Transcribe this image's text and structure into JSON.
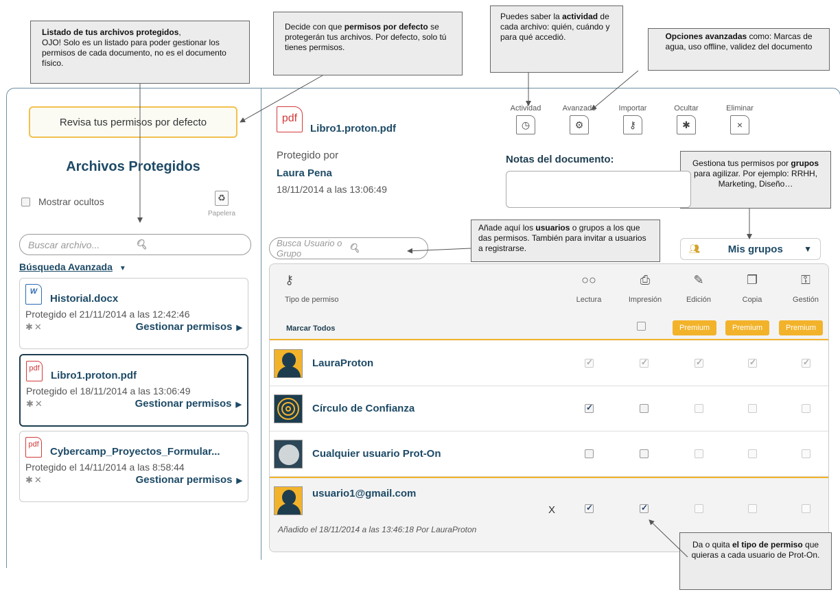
{
  "callouts": {
    "files_list": {
      "bold": "Listado de tus archivos protegidos",
      "text": "OJO! Solo es un listado para poder gestionar los permisos de cada documento, no es el documento físico."
    },
    "defaults": {
      "pre": "Decide con que ",
      "bold": "permisos por defecto",
      "text": " se protegerán tus archivos. Por defecto, solo tú tienes permisos."
    },
    "activity": {
      "pre": "Puedes saber la ",
      "bold": "actividad",
      "text": " de cada archivo: quién, cuándo y para qué accedió."
    },
    "advanced": {
      "bold": "Opciones avanzadas",
      "text": " como: Marcas de agua, uso offline, validez del documento"
    },
    "groups": {
      "pre": "Gestiona tus permisos por ",
      "bold": "grupos",
      "text": " para agilizar. Por ejemplo: RRHH, Marketing, Diseño…"
    },
    "users": {
      "pre": "Añade aquí los ",
      "bold": "usuarios",
      "text": " o grupos a los que das permisos. También para invitar a usuarios a registrarse."
    },
    "permission": {
      "pre": "Da o quita ",
      "bold": "el tipo de permiso",
      "text": " que quieras a cada usuario de Prot-On."
    }
  },
  "left": {
    "defaults_button": "Revisa tus permisos por defecto",
    "title": "Archivos Protegidos",
    "show_hidden": "Mostrar ocultos",
    "trash_label": "Papelera",
    "search_placeholder": "Buscar archivo...",
    "advanced_search": "Búsqueda Avanzada",
    "files": [
      {
        "type": "word",
        "icon_text": "W",
        "name": "Historial.docx",
        "date": "Protegido el 21/11/2014 a las 12:42:46",
        "manage": "Gestionar permisos"
      },
      {
        "type": "pdf",
        "icon_text": "pdf",
        "name": "Libro1.proton.pdf",
        "date": "Protegido el 18/11/2014 a las 13:06:49",
        "manage": "Gestionar permisos"
      },
      {
        "type": "pdf",
        "icon_text": "pdf",
        "name": "Cybercamp_Proyectos_Formular...",
        "date": "Protegido el 14/11/2014 a las 8:58:44",
        "manage": "Gestionar permisos"
      }
    ]
  },
  "document": {
    "icon_text": "pdf",
    "name": "Libro1.proton.pdf",
    "protected_by_label": "Protegido por",
    "owner": "Laura Pena",
    "date": "18/11/2014 a las 13:06:49",
    "notes_label": "Notas del documento:"
  },
  "actions": [
    {
      "label": "Actividad",
      "icon": "clock-icon",
      "glyph": "◷"
    },
    {
      "label": "Avanzado",
      "icon": "gear-icon",
      "glyph": "⚙"
    },
    {
      "label": "Importar",
      "icon": "key-icon",
      "glyph": "⚷"
    },
    {
      "label": "Ocultar",
      "icon": "hide-icon",
      "glyph": "✱"
    },
    {
      "label": "Eliminar",
      "icon": "close-icon",
      "glyph": "×"
    }
  ],
  "user_search_placeholder": "Busca Usuario o Grupo",
  "groups_button": "Mis grupos",
  "table": {
    "type_label": "Tipo de permiso",
    "columns": [
      {
        "label": "Lectura",
        "icon": "glasses-icon",
        "glyph": "○○"
      },
      {
        "label": "Impresión",
        "icon": "printer-icon",
        "glyph": "⎙"
      },
      {
        "label": "Edición",
        "icon": "pencil-icon",
        "glyph": "✎"
      },
      {
        "label": "Copia",
        "icon": "copy-icon",
        "glyph": "❐"
      },
      {
        "label": "Gestión",
        "icon": "key-icon",
        "glyph": "⚿"
      }
    ],
    "mark_all": "Marcar Todos",
    "premium": "Premium",
    "users": [
      {
        "name": "LauraProton",
        "avatar": "person",
        "perms": [
          true,
          true,
          true,
          true,
          true
        ],
        "dim": true
      },
      {
        "name": "Círculo de Confianza",
        "avatar": "target",
        "perms": [
          true,
          false,
          false,
          false,
          false
        ],
        "dim": false
      },
      {
        "name": "Cualquier usuario Prot-On",
        "avatar": "world",
        "perms": [
          false,
          false,
          false,
          false,
          false
        ],
        "dim": false
      },
      {
        "name": "usuario1@gmail.com",
        "avatar": "person",
        "perms": [
          true,
          true,
          false,
          false,
          false
        ],
        "dim": false,
        "remove": "X",
        "added": "Añadido el 18/11/2014 a las 13:46:18 Por LauraProton"
      }
    ]
  }
}
